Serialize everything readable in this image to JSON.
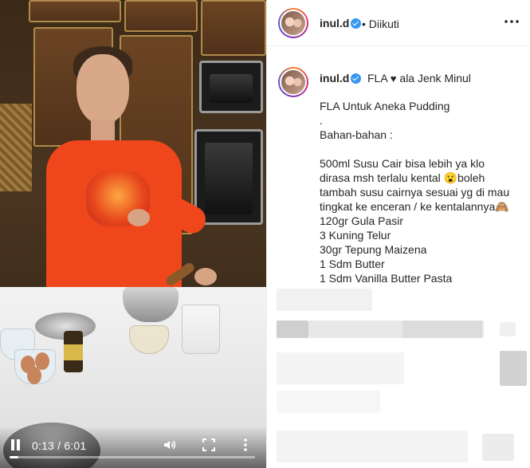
{
  "video": {
    "time_display": "0:13 / 6:01",
    "progress_fraction": 0.036,
    "controls": {
      "play_pause": "pause-icon",
      "volume": "volume-icon",
      "fullscreen": "fullscreen-icon",
      "more": "more-vertical-icon"
    }
  },
  "post": {
    "username": "inul.d",
    "follow_state": "• Diikuti",
    "more_options_icon": "more-horizontal-icon",
    "verified_color": "#3897f0"
  },
  "caption": {
    "title_prefix": "FLA",
    "title_heart": "♥",
    "title_suffix": "ala Jenk Minul",
    "lines": [
      "FLA Untuk Aneka Pudding",
      ".",
      "Bahan-bahan :",
      "",
      "500ml Susu Cair bisa lebih ya klo",
      "dirasa msh terlalu kental 😮boleh",
      "tambah susu cairnya sesuai yg di mau",
      "tingkat ke enceran / ke kentalannya🙈",
      "120gr Gula Pasir",
      "3 Kuning Telur",
      "30gr Tepung Maizena",
      "1 Sdm Butter",
      "1 Sdm Vanilla Butter Pasta"
    ]
  }
}
